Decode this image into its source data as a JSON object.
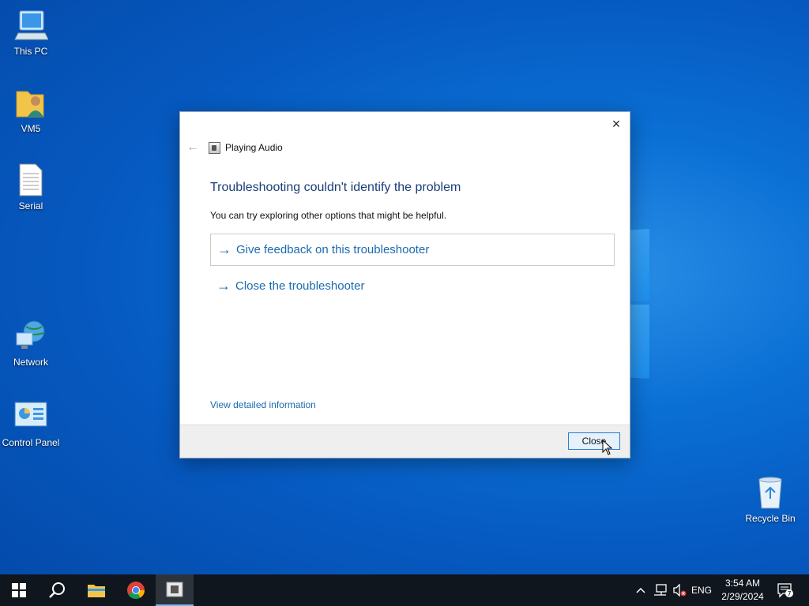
{
  "desktop": {
    "icons": [
      {
        "label": "This PC",
        "icon": "computer-icon"
      },
      {
        "label": "VM5",
        "icon": "user-folder-icon"
      },
      {
        "label": "Serial",
        "icon": "text-file-icon"
      },
      {
        "label": "Network",
        "icon": "network-icon"
      },
      {
        "label": "Control Panel",
        "icon": "control-panel-icon"
      },
      {
        "label": "Recycle Bin",
        "icon": "recycle-bin-icon"
      }
    ]
  },
  "dialog": {
    "app_title": "Playing Audio",
    "heading": "Troubleshooting couldn't identify the problem",
    "subtext": "You can try exploring other options that might be helpful.",
    "options": [
      {
        "label": "Give feedback on this troubleshooter"
      },
      {
        "label": "Close the troubleshooter"
      }
    ],
    "detail_link": "View detailed information",
    "close_button": "Close",
    "close_icon": "×",
    "back_icon": "←",
    "arrow_glyph": "→"
  },
  "taskbar": {
    "items": [
      "start-icon",
      "search-icon",
      "file-explorer-icon",
      "chrome-icon",
      "troubleshooter-icon"
    ],
    "tray": {
      "chevron": "^",
      "language": "ENG",
      "time": "3:54 AM",
      "date": "2/29/2024",
      "notification_count": "7"
    }
  },
  "colors": {
    "accent": "#1a6ab0",
    "heading": "#1c3d7a",
    "taskbar": "#10161d"
  }
}
